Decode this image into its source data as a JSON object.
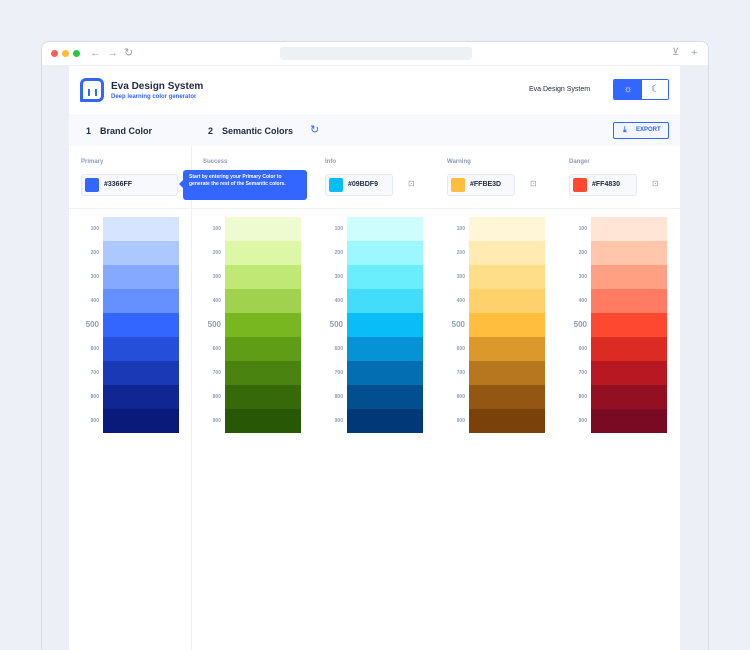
{
  "browser": {
    "icons": [
      "back-arrow-icon",
      "forward-arrow-icon",
      "reload-icon",
      "download-icon",
      "new-tab-icon"
    ]
  },
  "header": {
    "title": "Eva Design System",
    "subtitle": "Deep learning color generator",
    "right_label": "Eva Design System",
    "theme_light_icon": "☼",
    "theme_dark_icon": "☾"
  },
  "sections": {
    "brand": {
      "number": "1",
      "label": "Brand Color"
    },
    "semantic": {
      "number": "2",
      "label": "Semantic Colors"
    },
    "export_label": "EXPORT"
  },
  "tooltip": "Start by entering your Primary Color to generate the rest of the Semantic colors.",
  "shade_labels": [
    "100",
    "200",
    "300",
    "400",
    "500",
    "600",
    "700",
    "800",
    "900"
  ],
  "palettes": [
    {
      "name": "Primary",
      "hex": "#3366FF",
      "swatch": "#3366ff",
      "shades": [
        "#d6e4ff",
        "#adc8ff",
        "#84a9ff",
        "#6690ff",
        "#3366ff",
        "#254edb",
        "#1939b7",
        "#102693",
        "#091a7a"
      ]
    },
    {
      "name": "Success",
      "hex": "",
      "swatch": "",
      "shades": [
        "#eefbd1",
        "#dcf7a5",
        "#bfe874",
        "#a1d24f",
        "#78b71f",
        "#609d16",
        "#4a830f",
        "#366a09",
        "#285705"
      ]
    },
    {
      "name": "Info",
      "hex": "#09BDF9",
      "swatch": "#09bdf9",
      "shades": [
        "#cdfefd",
        "#9cf8fe",
        "#6aedfd",
        "#44dcfb",
        "#09bdf9",
        "#0693d6",
        "#046eb3",
        "#024f90",
        "#013877"
      ]
    },
    {
      "name": "Warning",
      "hex": "#FFBE3D",
      "swatch": "#ffbe3d",
      "shades": [
        "#fff6d8",
        "#ffebb1",
        "#ffde8a",
        "#ffd16c",
        "#ffbe3d",
        "#db992c",
        "#b7771e",
        "#935713",
        "#7a410b"
      ]
    },
    {
      "name": "Danger",
      "hex": "#FF4830",
      "swatch": "#ff4830",
      "shades": [
        "#ffe5d5",
        "#ffc6ac",
        "#ffa082",
        "#ff7c63",
        "#ff4830",
        "#db2b23",
        "#b71822",
        "#930f22",
        "#7a0923"
      ]
    }
  ]
}
